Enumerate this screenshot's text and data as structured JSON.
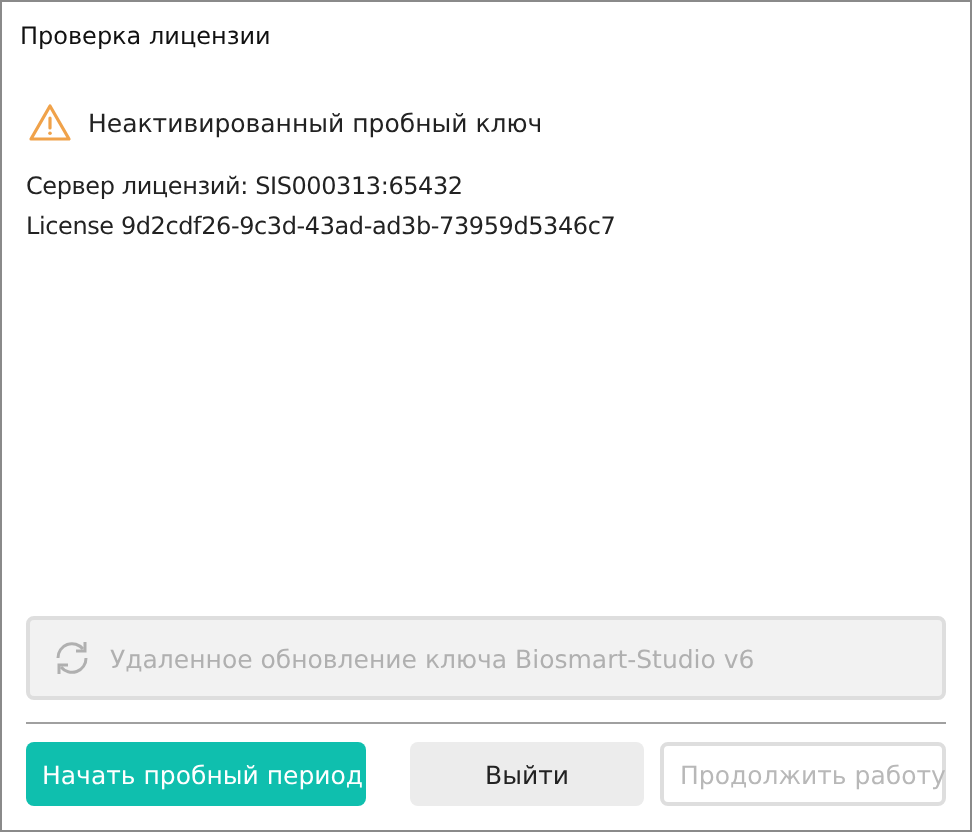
{
  "window": {
    "title": "Проверка лицензии"
  },
  "warning": {
    "text": "Неактивированный пробный ключ"
  },
  "info_lines": [
    "Сервер лицензий: SIS000313:65432",
    "License 9d2cdf26-9c3d-43ad-ad3b-73959d5346c7"
  ],
  "remote_update": {
    "label": "Удаленное обновление ключа Biosmart-Studio v6",
    "disabled": true
  },
  "buttons": [
    {
      "label": "Начать пробный период",
      "kind": "primary",
      "disabled": false
    },
    {
      "label": "Выйти",
      "kind": "secondary",
      "disabled": false
    },
    {
      "label": "Продолжить работу",
      "kind": "outline",
      "disabled": true
    }
  ]
}
